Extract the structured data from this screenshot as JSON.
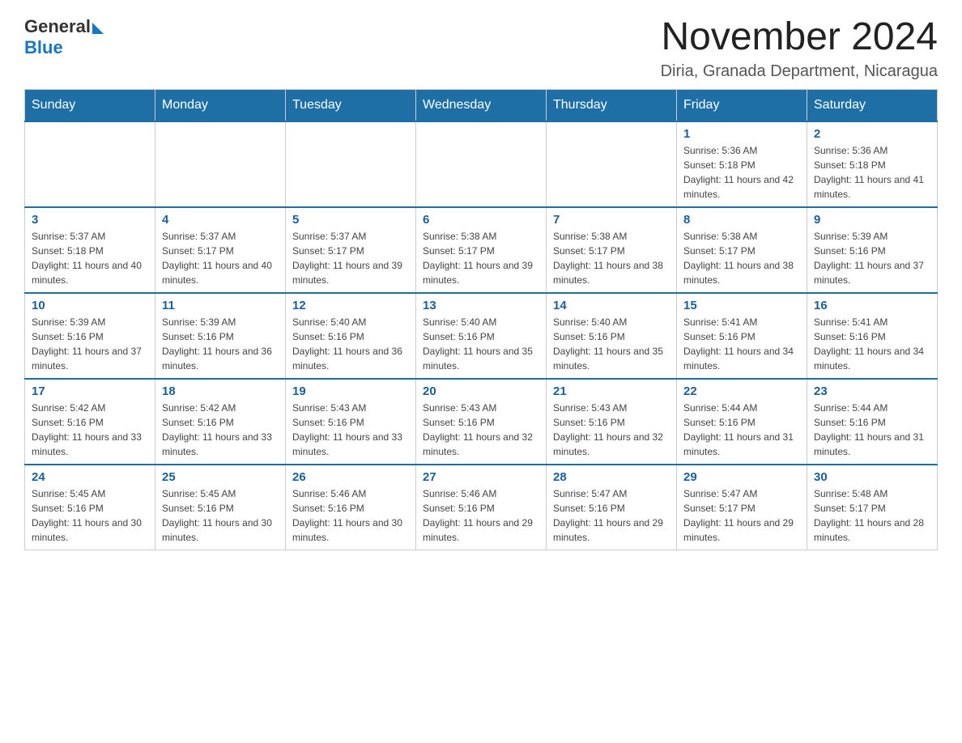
{
  "header": {
    "logo_general": "General",
    "logo_blue": "Blue",
    "title": "November 2024",
    "subtitle": "Diria, Granada Department, Nicaragua"
  },
  "weekdays": [
    "Sunday",
    "Monday",
    "Tuesday",
    "Wednesday",
    "Thursday",
    "Friday",
    "Saturday"
  ],
  "weeks": [
    [
      {
        "day": "",
        "info": ""
      },
      {
        "day": "",
        "info": ""
      },
      {
        "day": "",
        "info": ""
      },
      {
        "day": "",
        "info": ""
      },
      {
        "day": "",
        "info": ""
      },
      {
        "day": "1",
        "info": "Sunrise: 5:36 AM\nSunset: 5:18 PM\nDaylight: 11 hours and 42 minutes."
      },
      {
        "day": "2",
        "info": "Sunrise: 5:36 AM\nSunset: 5:18 PM\nDaylight: 11 hours and 41 minutes."
      }
    ],
    [
      {
        "day": "3",
        "info": "Sunrise: 5:37 AM\nSunset: 5:18 PM\nDaylight: 11 hours and 40 minutes."
      },
      {
        "day": "4",
        "info": "Sunrise: 5:37 AM\nSunset: 5:17 PM\nDaylight: 11 hours and 40 minutes."
      },
      {
        "day": "5",
        "info": "Sunrise: 5:37 AM\nSunset: 5:17 PM\nDaylight: 11 hours and 39 minutes."
      },
      {
        "day": "6",
        "info": "Sunrise: 5:38 AM\nSunset: 5:17 PM\nDaylight: 11 hours and 39 minutes."
      },
      {
        "day": "7",
        "info": "Sunrise: 5:38 AM\nSunset: 5:17 PM\nDaylight: 11 hours and 38 minutes."
      },
      {
        "day": "8",
        "info": "Sunrise: 5:38 AM\nSunset: 5:17 PM\nDaylight: 11 hours and 38 minutes."
      },
      {
        "day": "9",
        "info": "Sunrise: 5:39 AM\nSunset: 5:16 PM\nDaylight: 11 hours and 37 minutes."
      }
    ],
    [
      {
        "day": "10",
        "info": "Sunrise: 5:39 AM\nSunset: 5:16 PM\nDaylight: 11 hours and 37 minutes."
      },
      {
        "day": "11",
        "info": "Sunrise: 5:39 AM\nSunset: 5:16 PM\nDaylight: 11 hours and 36 minutes."
      },
      {
        "day": "12",
        "info": "Sunrise: 5:40 AM\nSunset: 5:16 PM\nDaylight: 11 hours and 36 minutes."
      },
      {
        "day": "13",
        "info": "Sunrise: 5:40 AM\nSunset: 5:16 PM\nDaylight: 11 hours and 35 minutes."
      },
      {
        "day": "14",
        "info": "Sunrise: 5:40 AM\nSunset: 5:16 PM\nDaylight: 11 hours and 35 minutes."
      },
      {
        "day": "15",
        "info": "Sunrise: 5:41 AM\nSunset: 5:16 PM\nDaylight: 11 hours and 34 minutes."
      },
      {
        "day": "16",
        "info": "Sunrise: 5:41 AM\nSunset: 5:16 PM\nDaylight: 11 hours and 34 minutes."
      }
    ],
    [
      {
        "day": "17",
        "info": "Sunrise: 5:42 AM\nSunset: 5:16 PM\nDaylight: 11 hours and 33 minutes."
      },
      {
        "day": "18",
        "info": "Sunrise: 5:42 AM\nSunset: 5:16 PM\nDaylight: 11 hours and 33 minutes."
      },
      {
        "day": "19",
        "info": "Sunrise: 5:43 AM\nSunset: 5:16 PM\nDaylight: 11 hours and 33 minutes."
      },
      {
        "day": "20",
        "info": "Sunrise: 5:43 AM\nSunset: 5:16 PM\nDaylight: 11 hours and 32 minutes."
      },
      {
        "day": "21",
        "info": "Sunrise: 5:43 AM\nSunset: 5:16 PM\nDaylight: 11 hours and 32 minutes."
      },
      {
        "day": "22",
        "info": "Sunrise: 5:44 AM\nSunset: 5:16 PM\nDaylight: 11 hours and 31 minutes."
      },
      {
        "day": "23",
        "info": "Sunrise: 5:44 AM\nSunset: 5:16 PM\nDaylight: 11 hours and 31 minutes."
      }
    ],
    [
      {
        "day": "24",
        "info": "Sunrise: 5:45 AM\nSunset: 5:16 PM\nDaylight: 11 hours and 30 minutes."
      },
      {
        "day": "25",
        "info": "Sunrise: 5:45 AM\nSunset: 5:16 PM\nDaylight: 11 hours and 30 minutes."
      },
      {
        "day": "26",
        "info": "Sunrise: 5:46 AM\nSunset: 5:16 PM\nDaylight: 11 hours and 30 minutes."
      },
      {
        "day": "27",
        "info": "Sunrise: 5:46 AM\nSunset: 5:16 PM\nDaylight: 11 hours and 29 minutes."
      },
      {
        "day": "28",
        "info": "Sunrise: 5:47 AM\nSunset: 5:16 PM\nDaylight: 11 hours and 29 minutes."
      },
      {
        "day": "29",
        "info": "Sunrise: 5:47 AM\nSunset: 5:17 PM\nDaylight: 11 hours and 29 minutes."
      },
      {
        "day": "30",
        "info": "Sunrise: 5:48 AM\nSunset: 5:17 PM\nDaylight: 11 hours and 28 minutes."
      }
    ]
  ]
}
